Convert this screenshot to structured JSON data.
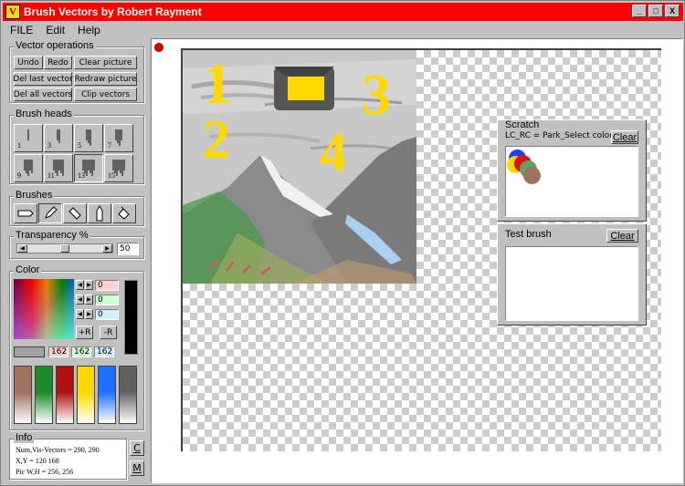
{
  "window": {
    "title": "Brush Vectors by Robert Rayment",
    "icon_letter": "V",
    "controls": [
      "_",
      "□",
      "X"
    ]
  },
  "menu": {
    "file": "FILE",
    "edit": "Edit",
    "help": "Help"
  },
  "vector_ops": {
    "title": "Vector operations",
    "undo": "Undo",
    "redo": "Redo",
    "clear_picture": "Clear picture",
    "del_last": "Del last vector",
    "redraw": "Redraw picture",
    "del_all": "Del all vectors",
    "clip": "Clip vectors"
  },
  "brush_heads": {
    "title": "Brush heads",
    "items": [
      "1",
      "3",
      "5",
      "7",
      "9",
      "11",
      "13",
      "15"
    ],
    "selected_index": 6
  },
  "brushes": {
    "title": "Brushes",
    "icons": [
      "flat-brush-icon",
      "pencil-brush-icon",
      "eraser-brush-icon",
      "upright-brush-icon",
      "fill-brush-icon"
    ],
    "selected_index": 1
  },
  "transparency": {
    "title": "Transparency %",
    "value": "50",
    "level_fraction": 0.5
  },
  "color": {
    "title": "Color",
    "r": "0",
    "g": "0",
    "b": "0",
    "plus_r": "+R",
    "minus_r": "-R",
    "sample_r": "162",
    "sample_g": "162",
    "sample_b": "162",
    "preview_color": "#000000",
    "sample_color": "#a2a2a2",
    "swatch_colors": [
      "#a07060",
      "#1e8a2a",
      "#b01010",
      "#ffd800",
      "#1f6fff",
      "#606060"
    ]
  },
  "info": {
    "title": "Info",
    "line1": "Num,Vis-Vectors = 290, 290",
    "line2": "X,Y = 120 168",
    "line3": "Pic W,H = 256, 256",
    "c_btn": "C",
    "m_btn": "M"
  },
  "painting": {
    "label_1": "1",
    "label_2": "2",
    "label_3": "3",
    "label_4": "4",
    "accent": "#ffd800"
  },
  "scratch": {
    "title": "Scratch",
    "hint": "LC_RC = Park_Select color",
    "clear": "Clear",
    "dots": [
      "#1f3fff",
      "#ffd800",
      "#e01010",
      "#60a060",
      "#a07060"
    ]
  },
  "test_brush": {
    "title": "Test brush",
    "clear": "Clear"
  }
}
